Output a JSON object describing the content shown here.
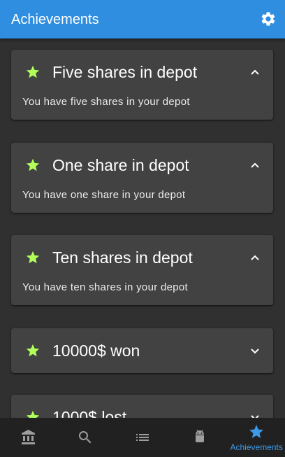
{
  "app_bar": {
    "title": "Achievements",
    "settings_icon": "gear-icon",
    "color": "#2f8ee0"
  },
  "achievements": [
    {
      "title": "Five shares in depot",
      "description": "You have five shares in your depot",
      "expanded": true
    },
    {
      "title": "One share in depot",
      "description": "You have one share in your depot",
      "expanded": true
    },
    {
      "title": "Ten shares in depot",
      "description": "You have ten shares in your depot",
      "expanded": true
    },
    {
      "title": "10000$ won",
      "description": "",
      "expanded": false
    },
    {
      "title": "1000$ lost",
      "description": "",
      "expanded": false
    }
  ],
  "colors": {
    "star": "#b2ff59",
    "card": "#424242",
    "background": "#303030",
    "nav_background": "#212121",
    "nav_active": "#3d9ae8",
    "nav_inactive": "#9e9e9e"
  },
  "bottom_nav": {
    "items": [
      {
        "icon": "bank-icon",
        "label": ""
      },
      {
        "icon": "search-icon",
        "label": ""
      },
      {
        "icon": "list-icon",
        "label": ""
      },
      {
        "icon": "android-icon",
        "label": ""
      },
      {
        "icon": "star-icon",
        "label": "Achievements",
        "active": true
      }
    ]
  }
}
